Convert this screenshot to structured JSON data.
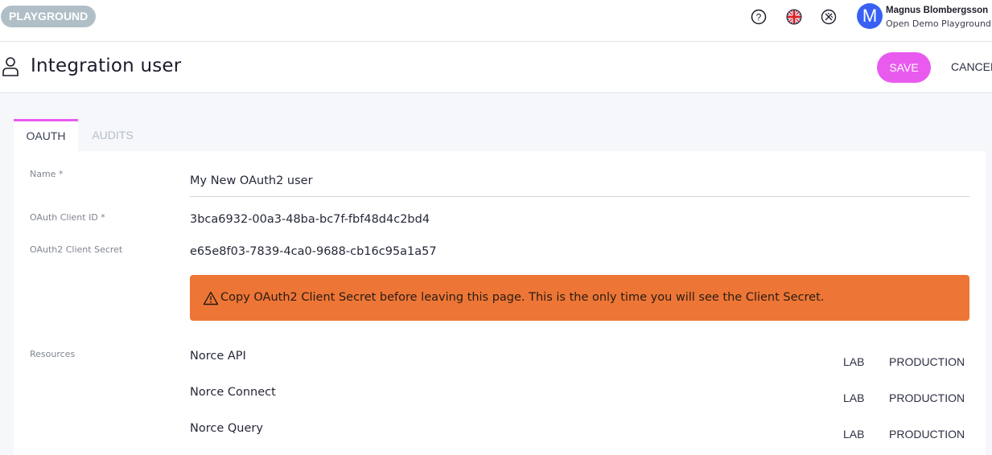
{
  "topbar": {
    "environment_badge": "PLAYGROUND",
    "icons": [
      "help-icon",
      "language-flag-uk-icon",
      "tools-off-icon"
    ],
    "user": {
      "avatar_initial": "M",
      "name": "Magnus Blombergsson",
      "organization": "Open Demo Playground"
    },
    "colors": {
      "avatar": "#3860f4",
      "badge": "#b0bec7"
    }
  },
  "header": {
    "title": "Integration user",
    "save_label": "SAVE",
    "cancel_label": "CANCEL",
    "accent_color": "#e95bef"
  },
  "tabs": [
    {
      "label": "OAUTH",
      "active": true
    },
    {
      "label": "AUDITS",
      "active": false
    }
  ],
  "form": {
    "name": {
      "label": "Name *",
      "value": "My New OAuth2 user"
    },
    "client_id": {
      "label": "OAuth Client ID *",
      "value": "3bca6932-00a3-48ba-bc7f-fbf48d4c2bd4"
    },
    "client_secret": {
      "label": "OAuth2 Client Secret",
      "value": "e65e8f03-7839-4ca0-9688-cb16c95a1a57"
    },
    "alert": {
      "icon": "warning-icon",
      "text": "Copy OAuth2 Client Secret before leaving this page. This is the only time you will see the Client Secret.",
      "color": "#ed7636"
    },
    "resources": {
      "label": "Resources",
      "items": [
        {
          "name": "Norce API",
          "lab_label": "LAB",
          "production_label": "PRODUCTION"
        },
        {
          "name": "Norce Connect",
          "lab_label": "LAB",
          "production_label": "PRODUCTION"
        },
        {
          "name": "Norce Query",
          "lab_label": "LAB",
          "production_label": "PRODUCTION"
        }
      ]
    }
  }
}
